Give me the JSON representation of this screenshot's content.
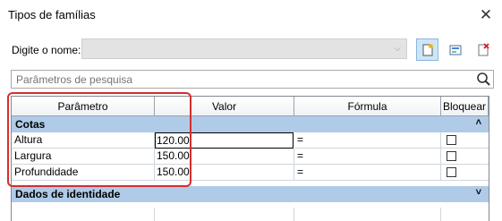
{
  "window": {
    "title": "Tipos de famílias",
    "close_label": "✕"
  },
  "name_field": {
    "label": "Digite o nome:",
    "value": ""
  },
  "toolbar": {
    "new_icon": "new-type-icon",
    "duplicate_icon": "rename-icon",
    "delete_icon": "delete-type-icon"
  },
  "search": {
    "placeholder": "Parâmetros de pesquisa",
    "icon": "search-icon"
  },
  "table": {
    "columns": [
      "Parâmetro",
      "Valor",
      "Fórmula",
      "Bloquear"
    ],
    "groups": [
      {
        "name": "Cotas",
        "chevron": "˄",
        "rows": [
          {
            "param": "Altura",
            "value": "120.00",
            "formula": "="
          },
          {
            "param": "Largura",
            "value": "150.00",
            "formula": "="
          },
          {
            "param": "Profundidade",
            "value": "150.00",
            "formula": "="
          }
        ]
      },
      {
        "name": "Dados de identidade",
        "chevron": "˅"
      }
    ]
  },
  "colors": {
    "group_header": "#afcbe8",
    "highlight": "#d32f2f",
    "active_button": "#cde6f7"
  }
}
